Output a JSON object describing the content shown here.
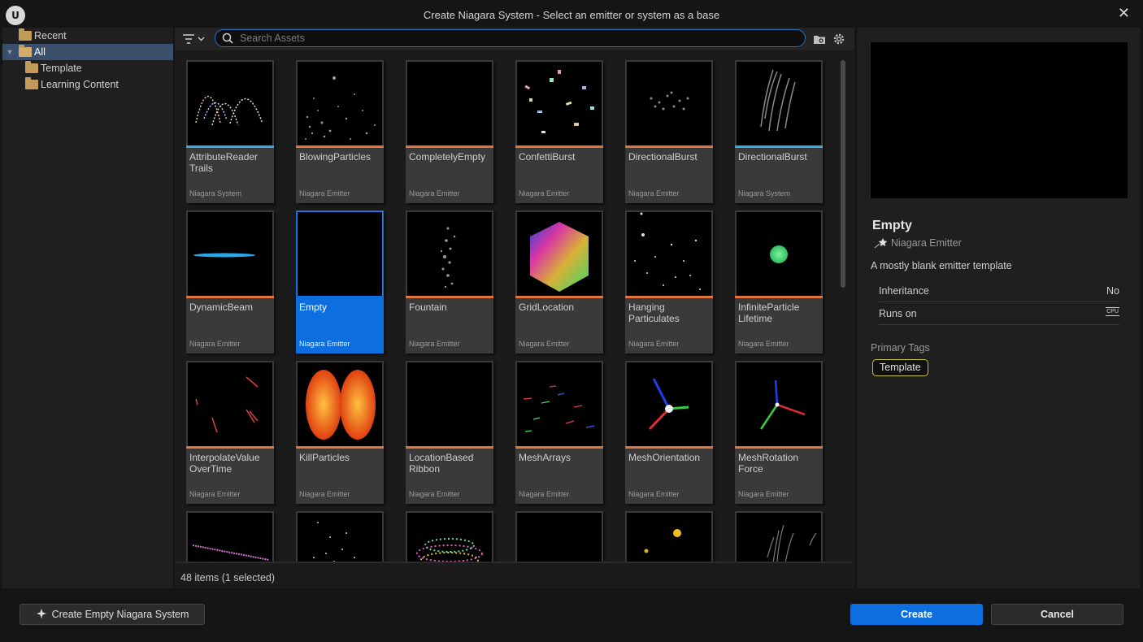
{
  "window": {
    "logo_letter": "U",
    "title": "Create Niagara System - Select an emitter or system as a base",
    "close_glyph": "✕"
  },
  "tree": {
    "items": [
      {
        "label": "Recent"
      },
      {
        "label": "All"
      },
      {
        "label": "Template"
      },
      {
        "label": "Learning Content"
      }
    ]
  },
  "toolbar": {
    "search_placeholder": "Search Assets"
  },
  "tiles": [
    {
      "name": "AttributeReader Trails",
      "type": "Niagara System"
    },
    {
      "name": "BlowingParticles",
      "type": "Niagara Emitter"
    },
    {
      "name": "CompletelyEmpty",
      "type": "Niagara Emitter"
    },
    {
      "name": "ConfettiBurst",
      "type": "Niagara Emitter"
    },
    {
      "name": "DirectionalBurst",
      "type": "Niagara Emitter"
    },
    {
      "name": "DirectionalBurst",
      "type": "Niagara System"
    },
    {
      "name": "DynamicBeam",
      "type": "Niagara Emitter"
    },
    {
      "name": "Empty",
      "type": "Niagara Emitter"
    },
    {
      "name": "Fountain",
      "type": "Niagara Emitter"
    },
    {
      "name": "GridLocation",
      "type": "Niagara Emitter"
    },
    {
      "name": "Hanging Particulates",
      "type": "Niagara Emitter"
    },
    {
      "name": "InfiniteParticle Lifetime",
      "type": "Niagara Emitter"
    },
    {
      "name": "InterpolateValue OverTime",
      "type": "Niagara Emitter"
    },
    {
      "name": "KillParticles",
      "type": "Niagara Emitter"
    },
    {
      "name": "LocationBased Ribbon",
      "type": "Niagara Emitter"
    },
    {
      "name": "MeshArrays",
      "type": "Niagara Emitter"
    },
    {
      "name": "MeshOrientation",
      "type": "Niagara Emitter"
    },
    {
      "name": "MeshRotation Force",
      "type": "Niagara Emitter"
    }
  ],
  "status": "48 items (1 selected)",
  "details": {
    "name": "Empty",
    "type": "Niagara Emitter",
    "description": "A mostly blank emitter template",
    "properties": [
      {
        "key": "Inheritance",
        "value": "No"
      },
      {
        "key": "Runs on",
        "value": ""
      }
    ],
    "cpu_label": "CPU",
    "primary_tags_label": "Primary Tags",
    "tags": [
      "Template"
    ]
  },
  "buttons": {
    "create_empty": "Create Empty Niagara System",
    "create": "Create",
    "cancel": "Cancel"
  },
  "colors": {
    "accent_blue": "#0d6ee0",
    "system_stripe": "#3da8e0",
    "emitter_stripe": "#e0743a",
    "tag_border": "#c8c13a"
  }
}
